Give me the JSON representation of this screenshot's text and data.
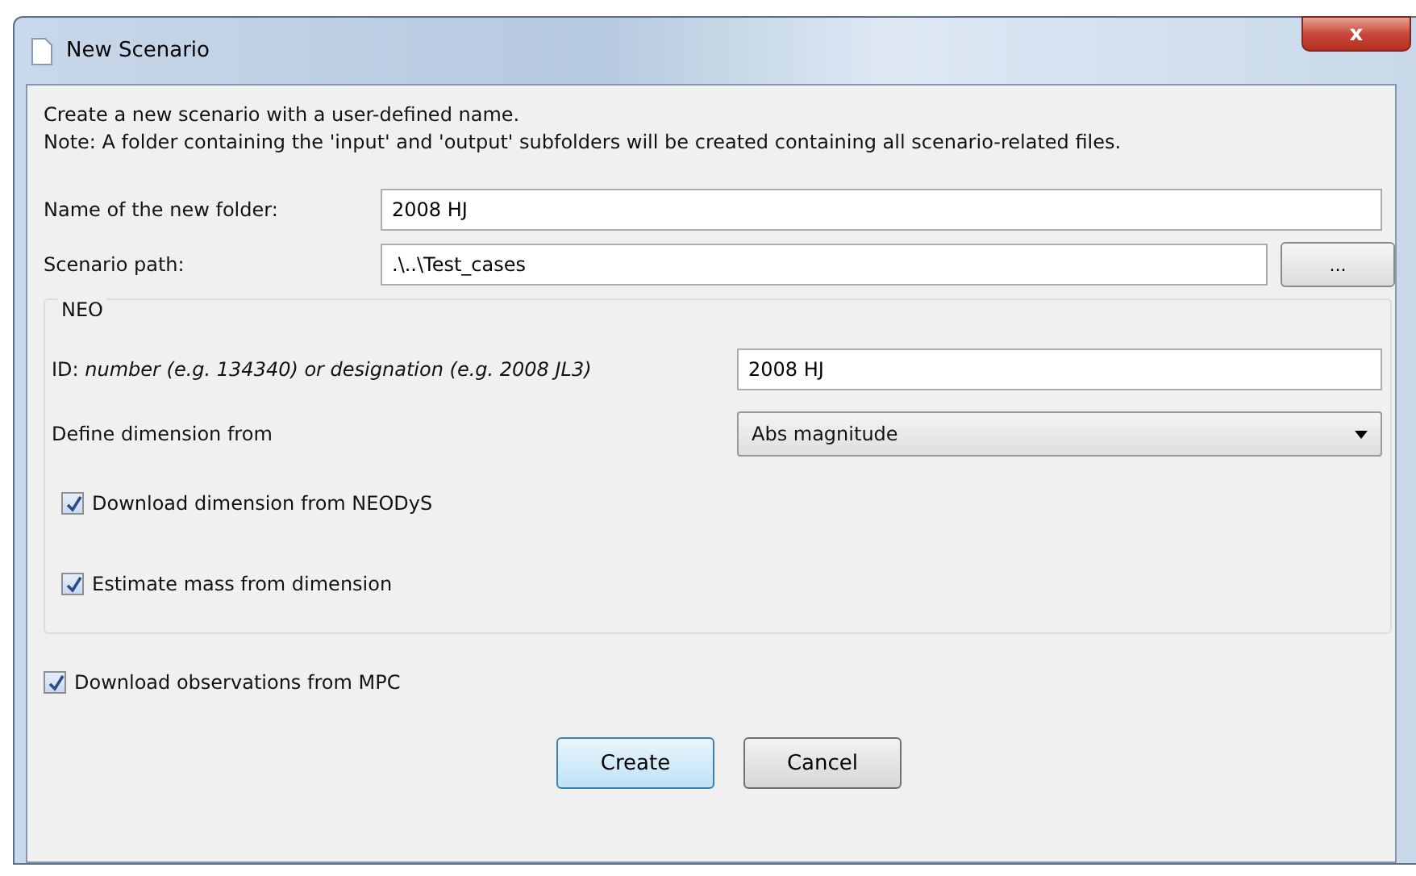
{
  "window": {
    "title": "New Scenario",
    "close": "x"
  },
  "intro": [
    "Create a new scenario with a user-defined name.",
    "Note: A folder containing the 'input' and 'output' subfolders will be created containing all scenario-related files."
  ],
  "folder": {
    "label": "Name of the new folder:",
    "value": "2008 HJ"
  },
  "path": {
    "label": "Scenario path:",
    "value": ".\\..\\Test_cases",
    "browse": "..."
  },
  "neo": {
    "title": "NEO",
    "id_label": "ID: *number (e.g. 134340) or designation (e.g. 2008 JL3)*",
    "id_value": "2008 HJ",
    "dimension_label": "Define dimension from",
    "dimension_value": "Abs magnitude",
    "options": [
      {
        "label": "Download dimension from NEODyS",
        "checked": true
      },
      {
        "label": "Estimate mass from dimension",
        "checked": true
      }
    ]
  },
  "observations": {
    "label": "Download observations from MPC",
    "checked": true
  },
  "buttons": [
    {
      "label": "Create",
      "selected": true
    },
    {
      "label": "Cancel",
      "selected": false
    }
  ]
}
